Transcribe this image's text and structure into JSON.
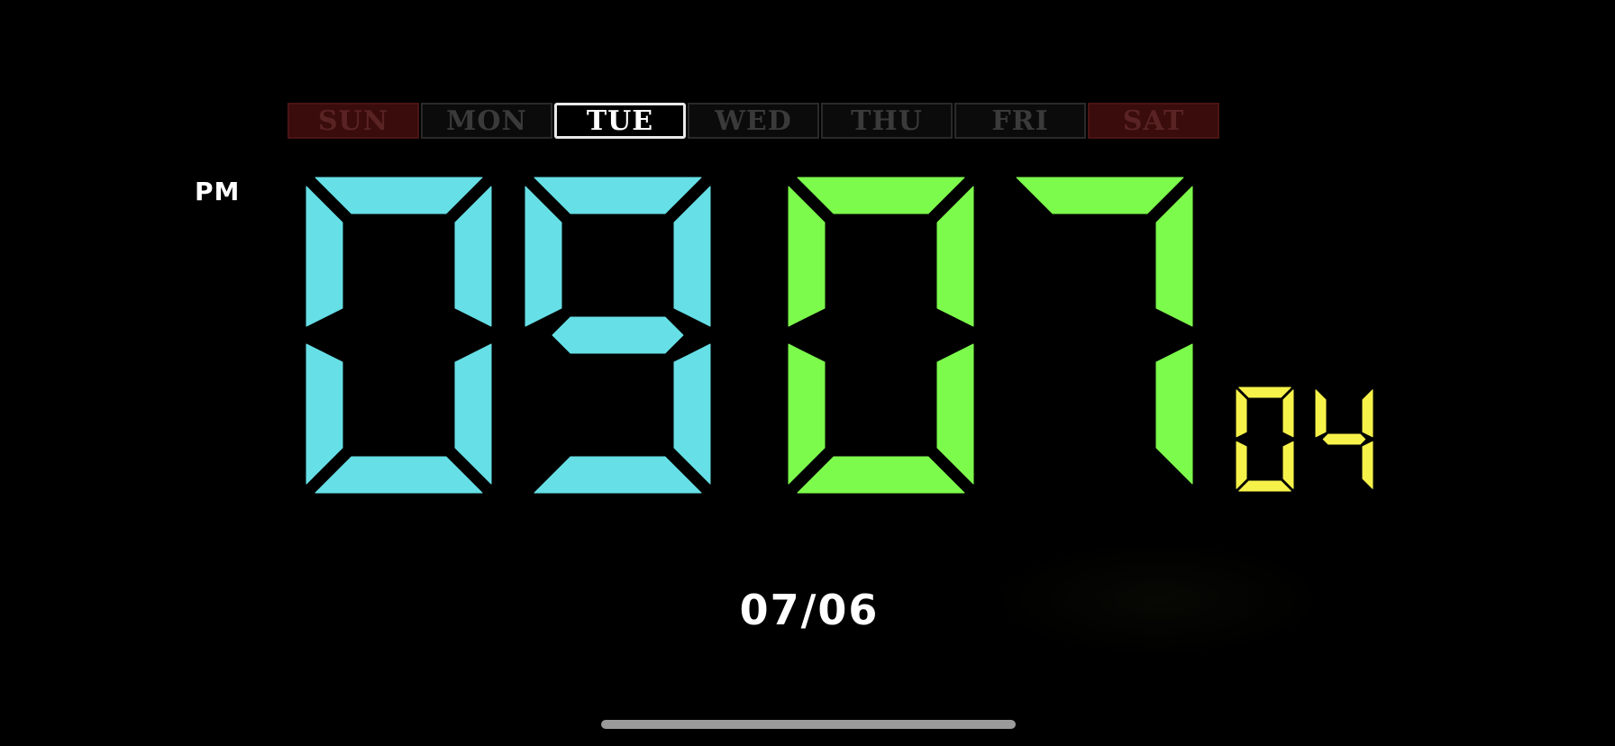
{
  "weekdays": [
    {
      "label": "SUN",
      "state": "weekend"
    },
    {
      "label": "MON",
      "state": "normal"
    },
    {
      "label": "TUE",
      "state": "active"
    },
    {
      "label": "WED",
      "state": "normal"
    },
    {
      "label": "THU",
      "state": "normal"
    },
    {
      "label": "FRI",
      "state": "normal"
    },
    {
      "label": "SAT",
      "state": "weekend"
    }
  ],
  "ampm": "PM",
  "time": {
    "hours": "09",
    "minutes": "07",
    "seconds": "04"
  },
  "date": "07/06",
  "colors": {
    "hours": "#66dfe6",
    "minutes": "#7dfb4c",
    "seconds": "#f6f24a"
  }
}
